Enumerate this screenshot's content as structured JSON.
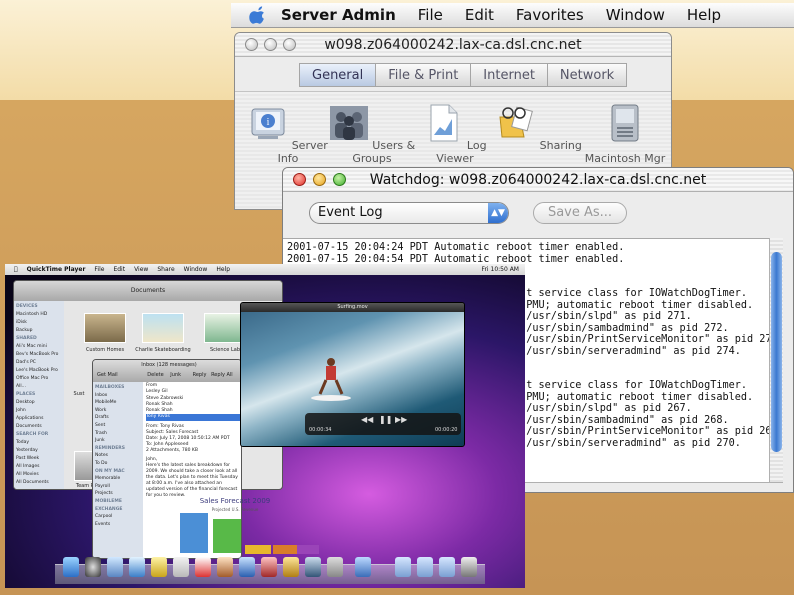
{
  "server_admin": {
    "menubar": {
      "app_name": "Server Admin",
      "items": [
        "File",
        "Edit",
        "Favorites",
        "Window",
        "Help"
      ]
    },
    "window_title": "w098.z064000242.lax-ca.dsl.cnc.net",
    "tabs": [
      {
        "label": "General",
        "active": true
      },
      {
        "label": "File & Print",
        "active": false
      },
      {
        "label": "Internet",
        "active": false
      },
      {
        "label": "Network",
        "active": false
      }
    ],
    "services": [
      {
        "label": "Server Info",
        "icon": "server-info-icon"
      },
      {
        "label": "Users & Groups",
        "icon": "users-groups-icon"
      },
      {
        "label": "Log Viewer",
        "icon": "log-viewer-icon"
      },
      {
        "label": "Sharing",
        "icon": "sharing-icon"
      },
      {
        "label": "Macintosh Mgr",
        "icon": "macintosh-mgr-icon"
      }
    ]
  },
  "watchdog": {
    "window_title": "Watchdog: w098.z064000242.lax-ca.dsl.cnc.net",
    "select_value": "Event Log",
    "save_as_label": "Save As...",
    "log": "2001-07-15 20:04:24 PDT Automatic reboot timer enabled.\n2001-07-15 20:04:54 PDT Automatic reboot timer enabled.\n\n\n                                       t service class for IOWatchDogTimer.\n                                       PMU; automatic reboot timer disabled.\n                                       /usr/sbin/slpd\" as pid 271.\n                                       /usr/sbin/sambadmind\" as pid 272.\n                                       /usr/sbin/PrintServiceMonitor\" as pid 273\n                                       /usr/sbin/serveradmind\" as pid 274.\n\n\n                                       t service class for IOWatchDogTimer.\n                                       PMU; automatic reboot timer disabled.\n                                       /usr/sbin/slpd\" as pid 267.\n                                       /usr/sbin/sambadmind\" as pid 268.\n                                       /usr/sbin/PrintServiceMonitor\" as pid 269\n                                       /usr/sbin/serveradmind\" as pid 270."
  },
  "leopard": {
    "menubar": {
      "app": "QuickTime Player",
      "items": [
        "File",
        "Edit",
        "View",
        "Share",
        "Window",
        "Help"
      ],
      "clock": "Fri 10:50 AM"
    },
    "finder": {
      "title": "Documents",
      "sidebar": [
        {
          "text": "DEVICES",
          "header": true
        },
        {
          "text": "Macintosh HD"
        },
        {
          "text": "iDisk"
        },
        {
          "text": "Backup"
        },
        {
          "text": "SHARED",
          "header": true
        },
        {
          "text": "Ali's Mac mini"
        },
        {
          "text": "Bev's MacBook Pro"
        },
        {
          "text": "Dad's PC"
        },
        {
          "text": "Lee's MacBook Pro"
        },
        {
          "text": "Office Mac Pro"
        },
        {
          "text": "All..."
        },
        {
          "text": "PLACES",
          "header": true
        },
        {
          "text": "Desktop"
        },
        {
          "text": "John"
        },
        {
          "text": "Applications"
        },
        {
          "text": "Documents"
        },
        {
          "text": "SEARCH FOR",
          "header": true
        },
        {
          "text": "Today"
        },
        {
          "text": "Yesterday"
        },
        {
          "text": "Past Week"
        },
        {
          "text": "All Images"
        },
        {
          "text": "All Movies"
        },
        {
          "text": "All Documents"
        }
      ],
      "items": [
        "Custom Homes",
        "Charlie Skateboarding",
        "Science Lab",
        "Team R",
        "Sust"
      ]
    },
    "mail": {
      "title": "Inbox (128 messages)",
      "toolbar": [
        "Get Mail",
        "Delete",
        "Junk",
        "Reply",
        "Reply All",
        "Forward"
      ],
      "sidebar": [
        {
          "text": "MAILBOXES",
          "header": true
        },
        {
          "text": "Inbox"
        },
        {
          "text": "MobileMe"
        },
        {
          "text": "Work"
        },
        {
          "text": "Drafts"
        },
        {
          "text": "Sent"
        },
        {
          "text": "Trash"
        },
        {
          "text": "Junk"
        },
        {
          "text": "REMINDERS",
          "header": true
        },
        {
          "text": "Notes"
        },
        {
          "text": "To Do"
        },
        {
          "text": "ON MY MAC",
          "header": true
        },
        {
          "text": "Memorable"
        },
        {
          "text": "Payroll"
        },
        {
          "text": "Projects"
        },
        {
          "text": "MOBILEME",
          "header": true
        },
        {
          "text": "EXCHANGE",
          "header": true
        },
        {
          "text": "Carpool"
        },
        {
          "text": "Events"
        }
      ],
      "messages": [
        {
          "from": "From",
          "sel": false
        },
        {
          "from": "Lesley Gil",
          "sel": false
        },
        {
          "from": "Steve Zabrowski",
          "sel": false
        },
        {
          "from": "Ronak Shah",
          "sel": false
        },
        {
          "from": "Ronak Shah",
          "sel": false
        },
        {
          "from": "Tony Rivas",
          "sel": true
        }
      ],
      "header": {
        "from": "From: Tony Rivas",
        "subject": "Subject: Sales Forecast",
        "date": "Date: July 17, 2008 10:50:12 AM PDT",
        "to": "To: John Appleseed",
        "attachments": "2 Attachments, 780 KB"
      },
      "greeting": "John,",
      "body": "Here's the latest sales breakdown for 2009. We should take a closer look at all the data. Let's plan to meet this Tuesday at 8:00 a.m. I've also attached an updated version of the financial forecast for you to review.",
      "chart_title": "Sales Forecast 2009",
      "chart_subtitle": "Projected U.S. Revenue"
    },
    "quicktime": {
      "title": "Surfing.mov",
      "time_elapsed": "00:00:34",
      "time_total": "00:00:20"
    }
  }
}
